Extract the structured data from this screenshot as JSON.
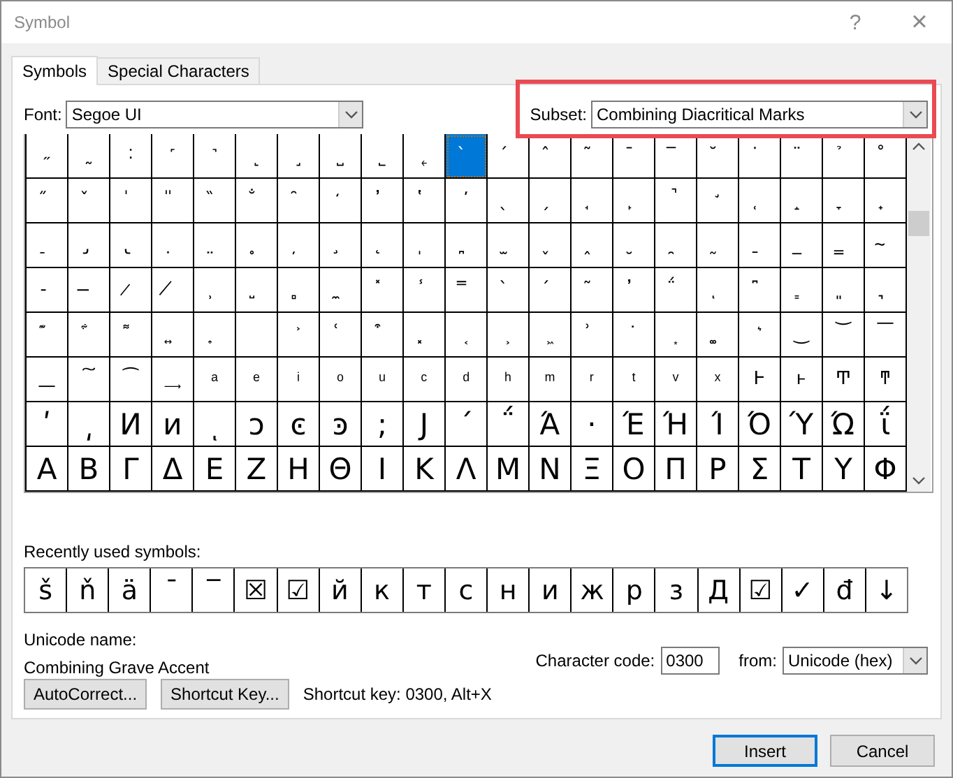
{
  "window": {
    "title": "Symbol",
    "help": "?",
    "close": "×"
  },
  "tabs": [
    {
      "label": "Symbols",
      "selected": true
    },
    {
      "label": "Special Characters",
      "selected": false
    }
  ],
  "font": {
    "label": "Font:",
    "value": "Segoe UI"
  },
  "subset": {
    "label": "Subset:",
    "value": "Combining Diacritical Marks",
    "highlighted": true
  },
  "grid": {
    "rows": [
      {
        "kind": "marks",
        "cells": [
          {
            "symbol": "˶",
            "selected": false
          },
          {
            "symbol": "˷",
            "selected": false
          },
          {
            "symbol": "˸",
            "selected": false
          },
          {
            "symbol": "˹",
            "selected": false
          },
          {
            "symbol": "˺",
            "selected": false
          },
          {
            "symbol": "˻",
            "selected": false
          },
          {
            "symbol": "˼",
            "selected": false
          },
          {
            "symbol": "˽",
            "selected": false
          },
          {
            "symbol": "˾",
            "selected": false
          },
          {
            "symbol": "˿",
            "selected": false
          },
          {
            "symbol": "̀",
            "selected": true
          },
          {
            "symbol": "́",
            "selected": false
          },
          {
            "symbol": "̂",
            "selected": false
          },
          {
            "symbol": "̃",
            "selected": false
          },
          {
            "symbol": "̄",
            "selected": false
          },
          {
            "symbol": "̅",
            "selected": false
          },
          {
            "symbol": "̆",
            "selected": false
          },
          {
            "symbol": "̇",
            "selected": false
          },
          {
            "symbol": "̈",
            "selected": false
          },
          {
            "symbol": "̉",
            "selected": false
          },
          {
            "symbol": "̊",
            "selected": false
          }
        ]
      },
      {
        "kind": "marks",
        "cells": [
          {
            "symbol": "̋",
            "selected": false
          },
          {
            "symbol": "̌",
            "selected": false
          },
          {
            "symbol": "̍",
            "selected": false
          },
          {
            "symbol": "̎",
            "selected": false
          },
          {
            "symbol": "̏",
            "selected": false
          },
          {
            "symbol": "̐",
            "selected": false
          },
          {
            "symbol": "̑",
            "selected": false
          },
          {
            "symbol": "̒",
            "selected": false
          },
          {
            "symbol": "̓",
            "selected": false
          },
          {
            "symbol": "̔",
            "selected": false
          },
          {
            "symbol": "̕",
            "selected": false
          },
          {
            "symbol": "̖",
            "selected": false
          },
          {
            "symbol": "̗",
            "selected": false
          },
          {
            "symbol": "̘",
            "selected": false
          },
          {
            "symbol": "̙",
            "selected": false
          },
          {
            "symbol": "̚",
            "selected": false
          },
          {
            "symbol": "̛",
            "selected": false
          },
          {
            "symbol": "̜",
            "selected": false
          },
          {
            "symbol": "̝",
            "selected": false
          },
          {
            "symbol": "̞",
            "selected": false
          },
          {
            "symbol": "̟",
            "selected": false
          }
        ]
      },
      {
        "kind": "marks",
        "cells": [
          {
            "symbol": "̠",
            "selected": false
          },
          {
            "symbol": "̡",
            "selected": false
          },
          {
            "symbol": "̢",
            "selected": false
          },
          {
            "symbol": "̣",
            "selected": false
          },
          {
            "symbol": "̤",
            "selected": false
          },
          {
            "symbol": "̥",
            "selected": false
          },
          {
            "symbol": "̦",
            "selected": false
          },
          {
            "symbol": "̧",
            "selected": false
          },
          {
            "symbol": "̨",
            "selected": false
          },
          {
            "symbol": "̩",
            "selected": false
          },
          {
            "symbol": "̪",
            "selected": false
          },
          {
            "symbol": "̫",
            "selected": false
          },
          {
            "symbol": "̬",
            "selected": false
          },
          {
            "symbol": "̭",
            "selected": false
          },
          {
            "symbol": "̮",
            "selected": false
          },
          {
            "symbol": "̯",
            "selected": false
          },
          {
            "symbol": "̰",
            "selected": false
          },
          {
            "symbol": "̱",
            "selected": false
          },
          {
            "symbol": "̲",
            "selected": false
          },
          {
            "symbol": "̳",
            "selected": false
          },
          {
            "symbol": "̴",
            "selected": false
          }
        ]
      },
      {
        "kind": "marks",
        "cells": [
          {
            "symbol": "̵",
            "selected": false
          },
          {
            "symbol": "̶",
            "selected": false
          },
          {
            "symbol": "̷",
            "selected": false
          },
          {
            "symbol": "̸",
            "selected": false
          },
          {
            "symbol": "̹",
            "selected": false
          },
          {
            "symbol": "̺",
            "selected": false
          },
          {
            "symbol": "̻",
            "selected": false
          },
          {
            "symbol": "̼",
            "selected": false
          },
          {
            "symbol": "̽",
            "selected": false
          },
          {
            "symbol": "̾",
            "selected": false
          },
          {
            "symbol": "̿",
            "selected": false
          },
          {
            "symbol": "̀",
            "selected": false
          },
          {
            "symbol": "́",
            "selected": false
          },
          {
            "symbol": "͂",
            "selected": false
          },
          {
            "symbol": "̓",
            "selected": false
          },
          {
            "symbol": "̈́",
            "selected": false
          },
          {
            "symbol": "ͅ",
            "selected": false
          },
          {
            "symbol": "͆",
            "selected": false
          },
          {
            "symbol": "͇",
            "selected": false
          },
          {
            "symbol": "͈",
            "selected": false
          },
          {
            "symbol": "͉",
            "selected": false
          }
        ]
      },
      {
        "kind": "marks",
        "cells": [
          {
            "symbol": "͊",
            "selected": false
          },
          {
            "symbol": "͋",
            "selected": false
          },
          {
            "symbol": "͌",
            "selected": false
          },
          {
            "symbol": "͍",
            "selected": false
          },
          {
            "symbol": "͎",
            "selected": false
          },
          {
            "selected": false
          },
          {
            "symbol": "͐",
            "selected": false
          },
          {
            "symbol": "͑",
            "selected": false
          },
          {
            "symbol": "͒",
            "selected": false
          },
          {
            "symbol": "͓",
            "selected": false
          },
          {
            "symbol": "͔",
            "selected": false
          },
          {
            "symbol": "͕",
            "selected": false
          },
          {
            "symbol": "͖",
            "selected": false
          },
          {
            "symbol": "͗",
            "selected": false
          },
          {
            "symbol": "͘",
            "selected": false
          },
          {
            "symbol": "͙",
            "selected": false
          },
          {
            "symbol": "͚",
            "selected": false
          },
          {
            "symbol": "͛",
            "selected": false
          },
          {
            "symbol": "͜",
            "selected": false
          },
          {
            "symbol": "͝",
            "selected": false
          },
          {
            "symbol": "͞",
            "selected": false
          }
        ]
      },
      {
        "kind": "small",
        "cells": [
          {
            "symbol": "͟",
            "selected": false
          },
          {
            "symbol": "͠",
            "selected": false
          },
          {
            "symbol": "͡",
            "selected": false
          },
          {
            "symbol": "͢",
            "selected": false
          },
          {
            "symbol": "ͣ",
            "selected": false
          },
          {
            "symbol": "ͤ",
            "selected": false
          },
          {
            "symbol": "ͥ",
            "selected": false
          },
          {
            "symbol": "ͦ",
            "selected": false
          },
          {
            "symbol": "ͧ",
            "selected": false
          },
          {
            "symbol": "ͨ",
            "selected": false
          },
          {
            "symbol": "ͩ",
            "selected": false
          },
          {
            "symbol": "ͪ",
            "selected": false
          },
          {
            "symbol": "ͫ",
            "selected": false
          },
          {
            "symbol": "ͬ",
            "selected": false
          },
          {
            "symbol": "ͭ",
            "selected": false
          },
          {
            "symbol": "ͮ",
            "selected": false
          },
          {
            "symbol": "ͯ",
            "selected": false
          },
          {
            "symbol": "Ͱ",
            "selected": false
          },
          {
            "symbol": "ͱ",
            "selected": false
          },
          {
            "symbol": "Ͳ",
            "selected": false
          },
          {
            "symbol": "ͳ",
            "selected": false
          }
        ]
      },
      {
        "kind": "large",
        "cells": [
          {
            "symbol": "ʹ",
            "selected": false
          },
          {
            "symbol": "͵",
            "selected": false
          },
          {
            "symbol": "Ͷ",
            "selected": false
          },
          {
            "symbol": "ͷ",
            "selected": false
          },
          {
            "symbol": "ͺ",
            "selected": false
          },
          {
            "symbol": "ͻ",
            "selected": false
          },
          {
            "symbol": "ͼ",
            "selected": false
          },
          {
            "symbol": "ͽ",
            "selected": false
          },
          {
            "symbol": ";",
            "selected": false
          },
          {
            "symbol": "Ϳ",
            "selected": false
          },
          {
            "symbol": "΄",
            "selected": false
          },
          {
            "symbol": "΅",
            "selected": false
          },
          {
            "symbol": "Ά",
            "selected": false
          },
          {
            "symbol": "·",
            "selected": false
          },
          {
            "symbol": "Έ",
            "selected": false
          },
          {
            "symbol": "Ή",
            "selected": false
          },
          {
            "symbol": "Ί",
            "selected": false
          },
          {
            "symbol": "Ό",
            "selected": false
          },
          {
            "symbol": "Ύ",
            "selected": false
          },
          {
            "symbol": "Ώ",
            "selected": false
          },
          {
            "symbol": "ΐ",
            "selected": false
          }
        ]
      },
      {
        "kind": "large",
        "cells": [
          {
            "symbol": "Α",
            "selected": false
          },
          {
            "symbol": "Β",
            "selected": false
          },
          {
            "symbol": "Γ",
            "selected": false
          },
          {
            "symbol": "Δ",
            "selected": false
          },
          {
            "symbol": "Ε",
            "selected": false
          },
          {
            "symbol": "Ζ",
            "selected": false
          },
          {
            "symbol": "Η",
            "selected": false
          },
          {
            "symbol": "Θ",
            "selected": false
          },
          {
            "symbol": "Ι",
            "selected": false
          },
          {
            "symbol": "Κ",
            "selected": false
          },
          {
            "symbol": "Λ",
            "selected": false
          },
          {
            "symbol": "Μ",
            "selected": false
          },
          {
            "symbol": "Ν",
            "selected": false
          },
          {
            "symbol": "Ξ",
            "selected": false
          },
          {
            "symbol": "Ο",
            "selected": false
          },
          {
            "symbol": "Π",
            "selected": false
          },
          {
            "symbol": "Ρ",
            "selected": false
          },
          {
            "symbol": "Σ",
            "selected": false
          },
          {
            "symbol": "Τ",
            "selected": false
          },
          {
            "symbol": "Υ",
            "selected": false
          },
          {
            "symbol": "Φ",
            "selected": false
          }
        ]
      }
    ]
  },
  "recent": {
    "label": "Recently used symbols:",
    "symbols": [
      "š",
      "ň",
      "ä",
      "¯",
      "‾",
      "☒",
      "☑",
      "й",
      "к",
      "т",
      "с",
      "н",
      "и",
      "ж",
      "р",
      "з",
      "Д",
      "☑",
      "✓",
      "đ",
      "↓"
    ]
  },
  "unicode_name": {
    "label": "Unicode name:",
    "value": "Combining Grave Accent"
  },
  "character_code": {
    "label": "Character code:",
    "value": "0300"
  },
  "from": {
    "label": "from:",
    "value": "Unicode (hex)"
  },
  "buttons": [
    {
      "label": "AutoCorrect...",
      "default": false
    },
    {
      "label": "Shortcut Key...",
      "default": false
    }
  ],
  "shortcut_text": "Shortcut key: 0300, Alt+X",
  "footer_buttons": [
    {
      "label": "Insert",
      "default": true
    },
    {
      "label": "Cancel",
      "default": false
    }
  ]
}
